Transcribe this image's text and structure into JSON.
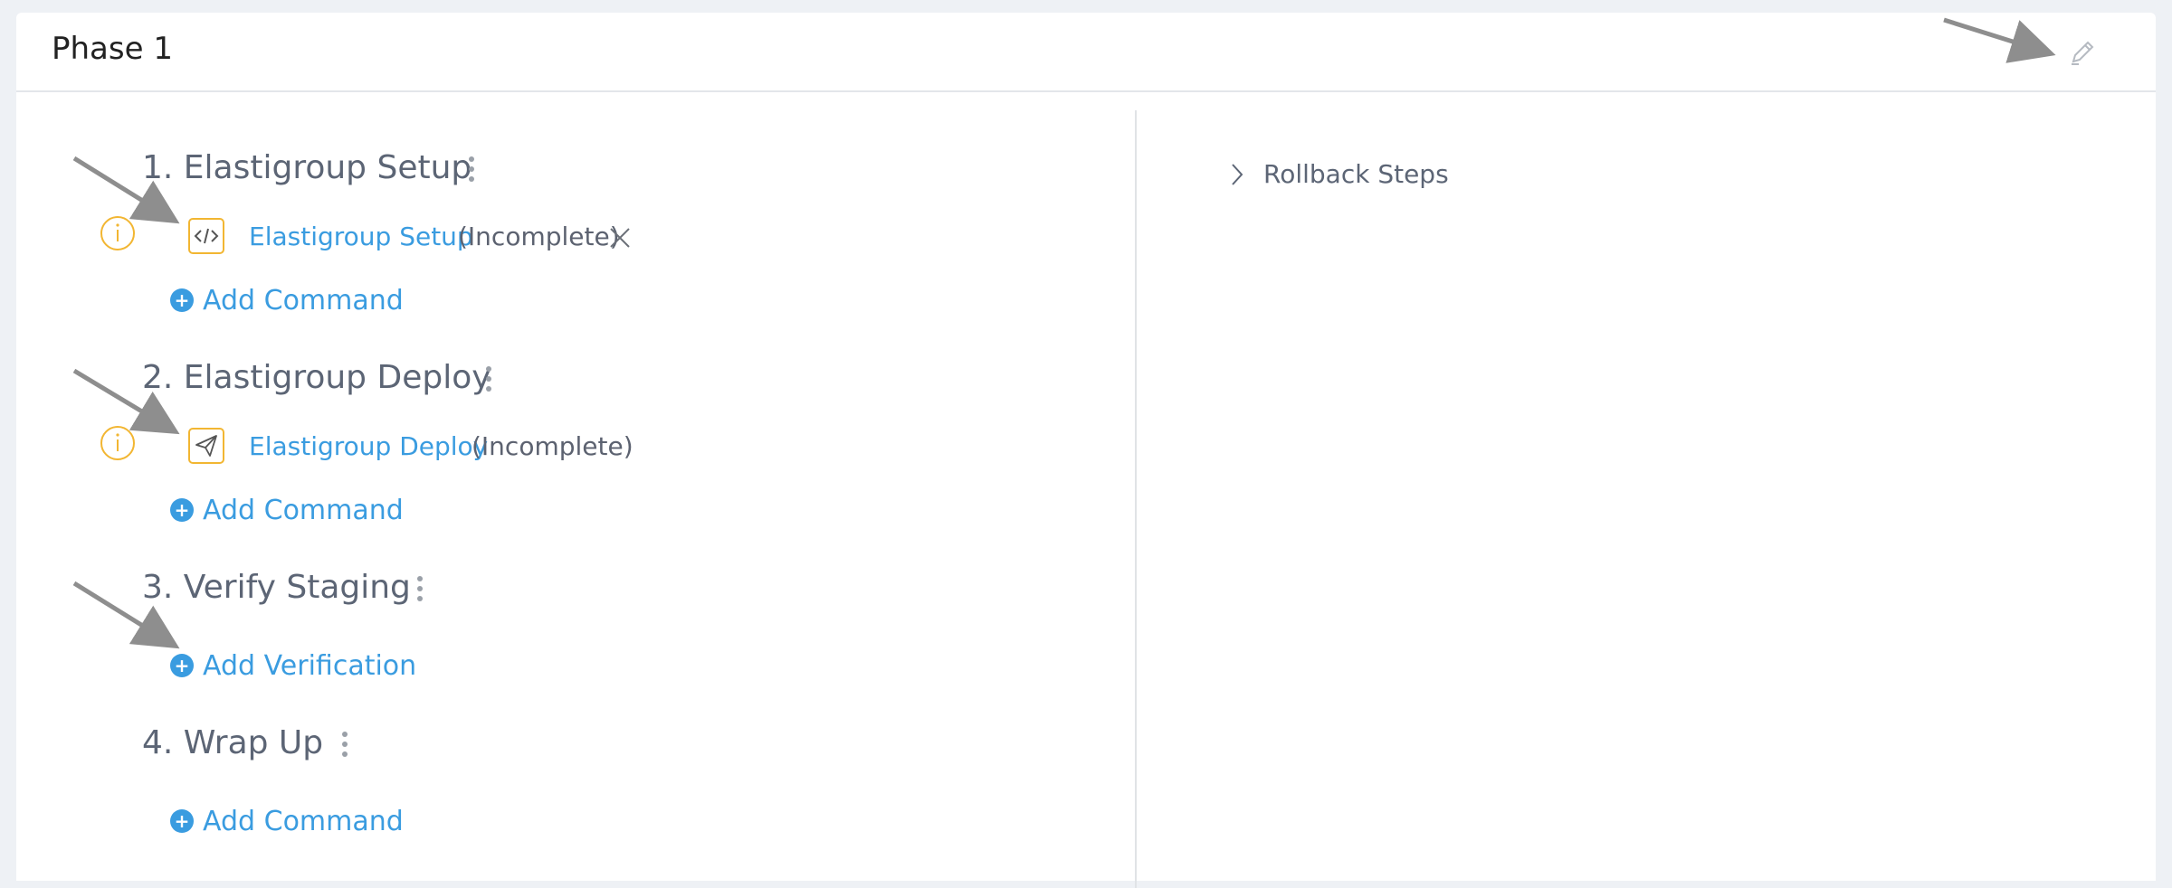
{
  "header": {
    "title": "Phase 1"
  },
  "steps": [
    {
      "title": "1. Elastigroup Setup",
      "command": {
        "name": "Elastigroup Setup",
        "status": "(Incomplete)",
        "icon": "code-icon"
      },
      "add_label": "Add Command"
    },
    {
      "title": "2. Elastigroup Deploy",
      "command": {
        "name": "Elastigroup Deploy",
        "status": "(Incomplete)",
        "icon": "paper-plane-icon"
      },
      "add_label": "Add Command"
    },
    {
      "title": "3. Verify Staging",
      "add_label": "Add Verification"
    },
    {
      "title": "4. Wrap Up",
      "add_label": "Add Command"
    }
  ],
  "rollback": {
    "label": "Rollback Steps"
  },
  "colors": {
    "link": "#3a9ce0",
    "warning": "#f2b632",
    "text": "#5c6575"
  }
}
